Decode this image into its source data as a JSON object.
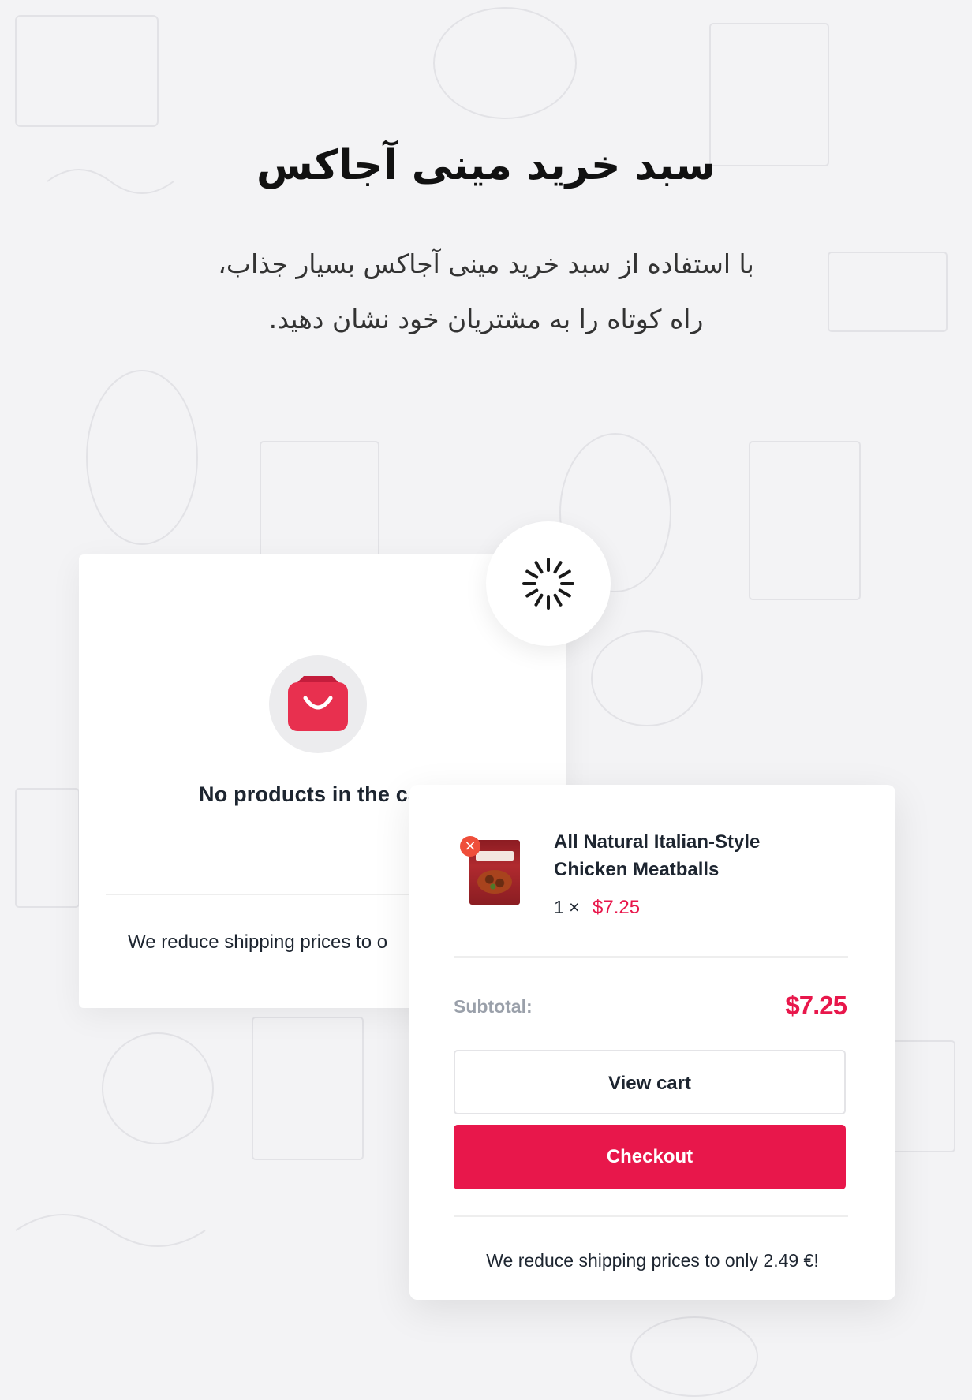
{
  "heading": {
    "title": "سبد خرید مینی آجاکس",
    "line1": "با استفاده از سبد خرید مینی آجاکس بسیار جذاب،",
    "line2": "راه کوتاه را به مشتریان خود نشان دهید."
  },
  "empty_cart": {
    "icon": "shopping-bag-icon",
    "message": "No products in the ca",
    "shipping_note": "We reduce shipping prices to o"
  },
  "loader": {
    "icon": "spinner-icon"
  },
  "mini_cart": {
    "item": {
      "name_line1": "All Natural Italian-Style",
      "name_line2": "Chicken Meatballs",
      "quantity": "1 ×",
      "price": "$7.25",
      "remove_symbol": "×"
    },
    "subtotal_label": "Subtotal:",
    "subtotal_value": "$7.25",
    "view_cart_label": "View cart",
    "checkout_label": "Checkout",
    "shipping_note": "We reduce shipping prices to only 2.49 €!"
  },
  "colors": {
    "accent": "#e8174b",
    "remove": "#ef4e3a",
    "background": "#f3f3f5"
  }
}
